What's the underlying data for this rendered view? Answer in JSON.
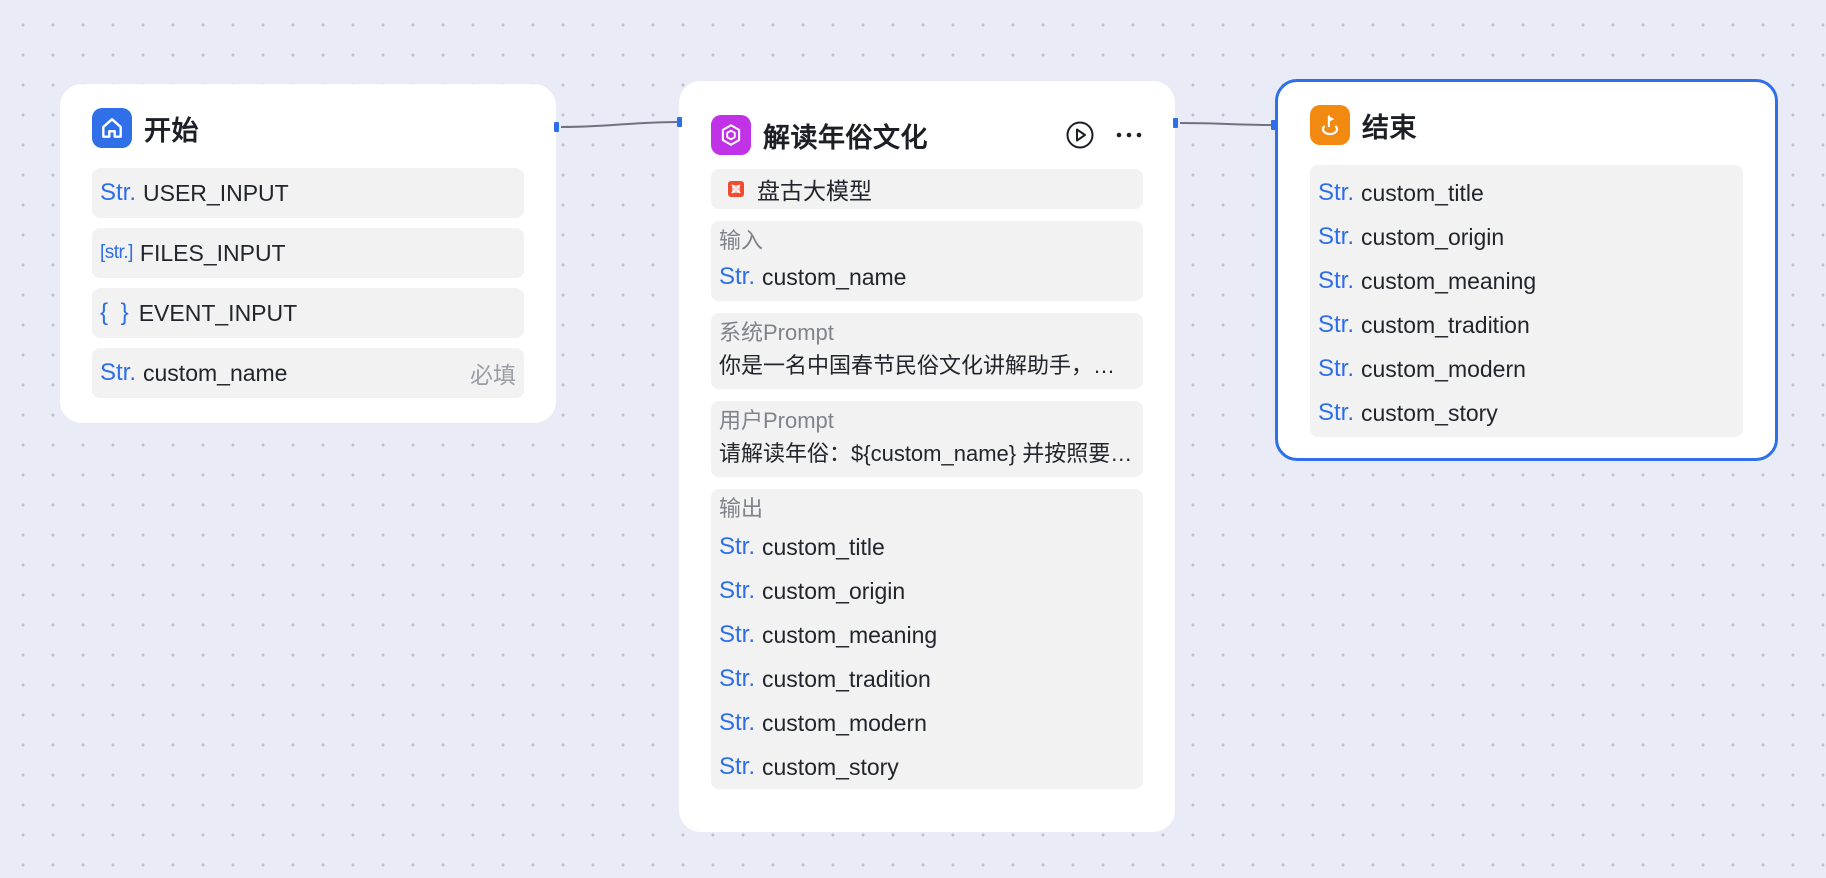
{
  "canvas": {
    "background": "#e9ecf7",
    "accent": "#2f6fe8"
  },
  "start_node": {
    "title": "开始",
    "icon": "home-icon",
    "icon_color": "#2f6fe8",
    "fields": [
      {
        "type": "Str.",
        "name": "USER_INPUT",
        "required": ""
      },
      {
        "type": "[str.]",
        "name": "FILES_INPUT",
        "required": ""
      },
      {
        "type": "{ }",
        "name": "EVENT_INPUT",
        "required": ""
      },
      {
        "type": "Str.",
        "name": "custom_name",
        "required": "必填"
      }
    ]
  },
  "llm_node": {
    "title": "解读年俗文化",
    "icon": "hexagon-cube-icon",
    "icon_color": "#c132e6",
    "model": {
      "icon": "pangu-model-icon",
      "name": "盘古大模型"
    },
    "input": {
      "label": "输入",
      "fields": [
        {
          "type": "Str.",
          "name": "custom_name"
        }
      ]
    },
    "system_prompt": {
      "label": "系统Prompt",
      "text": "你是一名中国春节民俗文化讲解助手，擅长用通俗易懂的语言介绍春节习俗。"
    },
    "user_prompt": {
      "label": "用户Prompt",
      "text": "请解读年俗：${custom_name} 并按照要求输出对应内容。"
    },
    "output": {
      "label": "输出",
      "fields": [
        {
          "type": "Str.",
          "name": "custom_title"
        },
        {
          "type": "Str.",
          "name": "custom_origin"
        },
        {
          "type": "Str.",
          "name": "custom_meaning"
        },
        {
          "type": "Str.",
          "name": "custom_tradition"
        },
        {
          "type": "Str.",
          "name": "custom_modern"
        },
        {
          "type": "Str.",
          "name": "custom_story"
        }
      ]
    }
  },
  "end_node": {
    "title": "结束",
    "icon": "flag-end-icon",
    "icon_color": "#f28a12",
    "fields": [
      {
        "type": "Str.",
        "name": "custom_title"
      },
      {
        "type": "Str.",
        "name": "custom_origin"
      },
      {
        "type": "Str.",
        "name": "custom_meaning"
      },
      {
        "type": "Str.",
        "name": "custom_tradition"
      },
      {
        "type": "Str.",
        "name": "custom_modern"
      },
      {
        "type": "Str.",
        "name": "custom_story"
      }
    ]
  }
}
